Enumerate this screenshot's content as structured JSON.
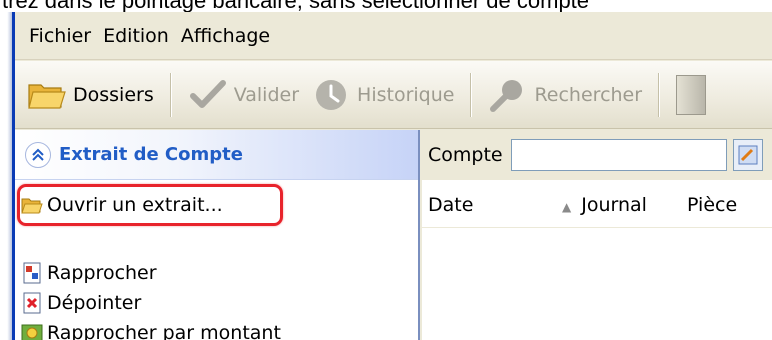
{
  "caption": "trez dans le pointage bancaire, sans sélectionner de compte",
  "menubar": {
    "items": [
      "Fichier",
      "Edition",
      "Affichage"
    ]
  },
  "toolbar": {
    "dossiers_label": "Dossiers",
    "valider_label": "Valider",
    "historique_label": "Historique",
    "rechercher_label": "Rechercher"
  },
  "taskpanel": {
    "title": "Extrait de Compte",
    "items": [
      {
        "label": "Ouvrir un extrait...",
        "icon": "folder-open-icon"
      },
      {
        "label": "Rapprocher",
        "icon": "reconcile-icon"
      },
      {
        "label": "Dépointer",
        "icon": "unmark-icon"
      },
      {
        "label": "Rapprocher par montant",
        "icon": "reconcile-amount-icon"
      }
    ]
  },
  "search": {
    "label": "Compte",
    "value": ""
  },
  "columns": {
    "date": "Date",
    "journal": "Journal",
    "piece": "Pièce"
  },
  "colors": {
    "accent": "#215dc6",
    "highlight": "#e8232b",
    "toolbar_bg": "#ece9d8"
  }
}
